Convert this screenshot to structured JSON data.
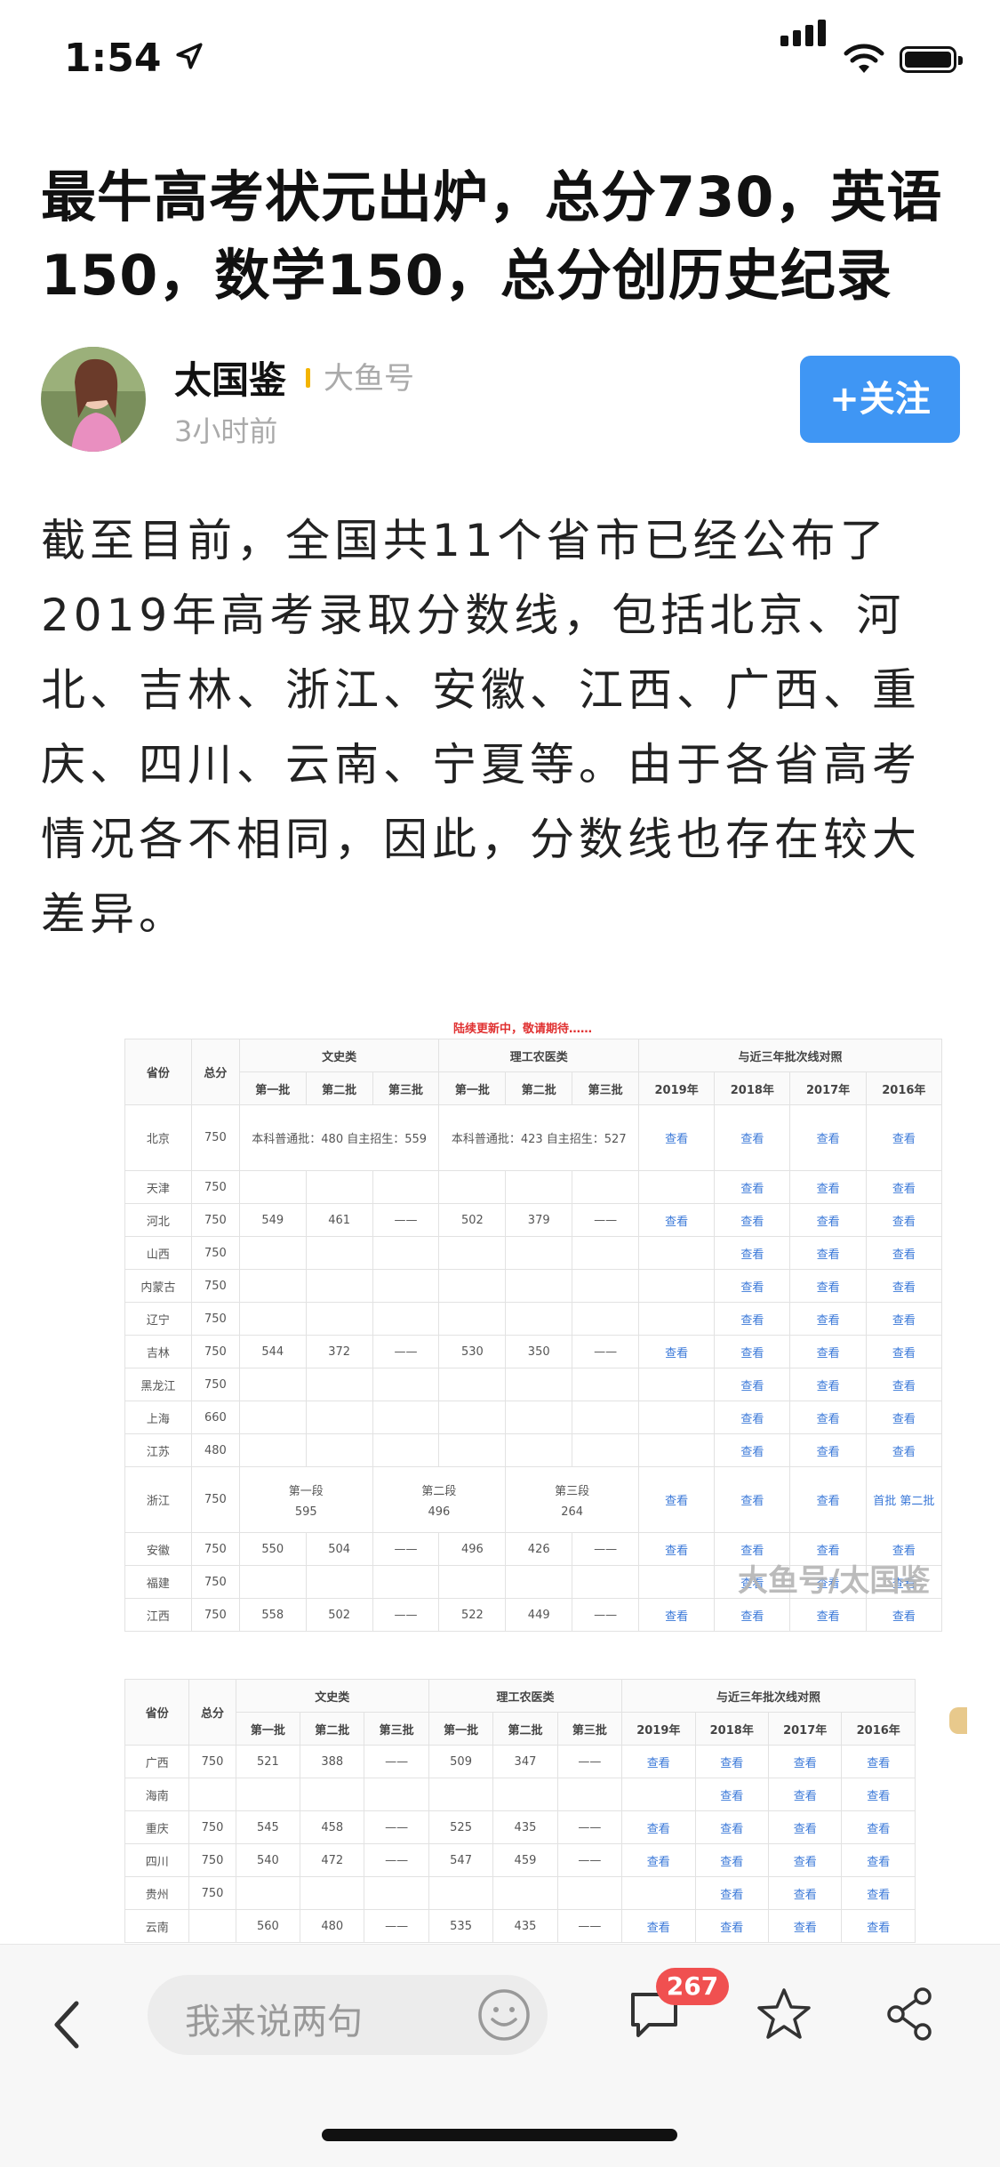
{
  "status_bar": {
    "time": "1:54"
  },
  "article": {
    "title": "最牛高考状元出炉，总分730，英语150，数学150，总分创历史纪录",
    "author": {
      "name": "太国鉴",
      "tag": "大鱼号",
      "time": "3小时前",
      "follow_label": "+关注"
    },
    "body": "截至目前，全国共11个省市已经公布了2019年高考录取分数线，包括北京、河北、吉林、浙江、安徽、江西、广西、重庆、四川、云南、宁夏等。由于各省高考情况各不相同，因此，分数线也存在较大差异。"
  },
  "table1": {
    "notice": "陆续更新中，敬请期待……",
    "headers": {
      "province": "省份",
      "total": "总分",
      "wen": "文史类",
      "li": "理工农医类",
      "compare": "与近三年批次线对照",
      "sub": [
        "第一批",
        "第二批",
        "第三批",
        "第一批",
        "第二批",
        "第三批",
        "2019年",
        "2018年",
        "2017年",
        "2016年"
      ]
    },
    "rows": [
      {
        "p": "北京",
        "t": "750",
        "special_wen": "本科普通批：480 自主招生：559",
        "special_li": "本科普通批：423 自主招生：527",
        "c2019": "查看"
      },
      {
        "p": "天津",
        "t": "750"
      },
      {
        "p": "河北",
        "t": "750",
        "w1": "549",
        "w2": "461",
        "w3": "——",
        "l1": "502",
        "l2": "379",
        "l3": "——",
        "c2019": "查看"
      },
      {
        "p": "山西",
        "t": "750"
      },
      {
        "p": "内蒙古",
        "t": "750"
      },
      {
        "p": "辽宁",
        "t": "750"
      },
      {
        "p": "吉林",
        "t": "750",
        "w1": "544",
        "w2": "372",
        "w3": "——",
        "l1": "530",
        "l2": "350",
        "l3": "——",
        "c2019": "查看"
      },
      {
        "p": "黑龙江",
        "t": "750"
      },
      {
        "p": "上海",
        "t": "660"
      },
      {
        "p": "江苏",
        "t": "480"
      },
      {
        "p": "浙江",
        "t": "750",
        "zj": [
          "第一段",
          "595",
          "第二段",
          "496",
          "第三段",
          "264"
        ],
        "c2019": "查看",
        "c2016": "首批 第二批"
      },
      {
        "p": "安徽",
        "t": "750",
        "w1": "550",
        "w2": "504",
        "w3": "——",
        "l1": "496",
        "l2": "426",
        "l3": "——",
        "c2019": "查看"
      },
      {
        "p": "福建",
        "t": "750"
      },
      {
        "p": "江西",
        "t": "750",
        "w1": "558",
        "w2": "502",
        "w3": "——",
        "l1": "522",
        "l2": "449",
        "l3": "——",
        "c2019": "查看"
      }
    ],
    "link_label": "查看",
    "watermark": "大鱼号/太国鉴"
  },
  "table2": {
    "rows": [
      {
        "p": "广西",
        "t": "750",
        "w1": "521",
        "w2": "388",
        "w3": "——",
        "l1": "509",
        "l2": "347",
        "l3": "——",
        "c2019": "查看"
      },
      {
        "p": "海南",
        "t": ""
      },
      {
        "p": "重庆",
        "t": "750",
        "w1": "545",
        "w2": "458",
        "w3": "——",
        "l1": "525",
        "l2": "435",
        "l3": "——",
        "c2019": "查看"
      },
      {
        "p": "四川",
        "t": "750",
        "w1": "540",
        "w2": "472",
        "w3": "——",
        "l1": "547",
        "l2": "459",
        "l3": "——",
        "c2019": "查看"
      },
      {
        "p": "贵州",
        "t": "750"
      },
      {
        "p": "云南",
        "t": "",
        "w1": "560",
        "w2": "480",
        "w3": "——",
        "l1": "535",
        "l2": "435",
        "l3": "——",
        "c2019": "查看"
      }
    ]
  },
  "bottom_bar": {
    "comment_placeholder": "我来说两句",
    "comment_count": "267"
  },
  "colors": {
    "accent": "#3f96f4",
    "badge": "#f05050",
    "link": "#3a78d8"
  }
}
